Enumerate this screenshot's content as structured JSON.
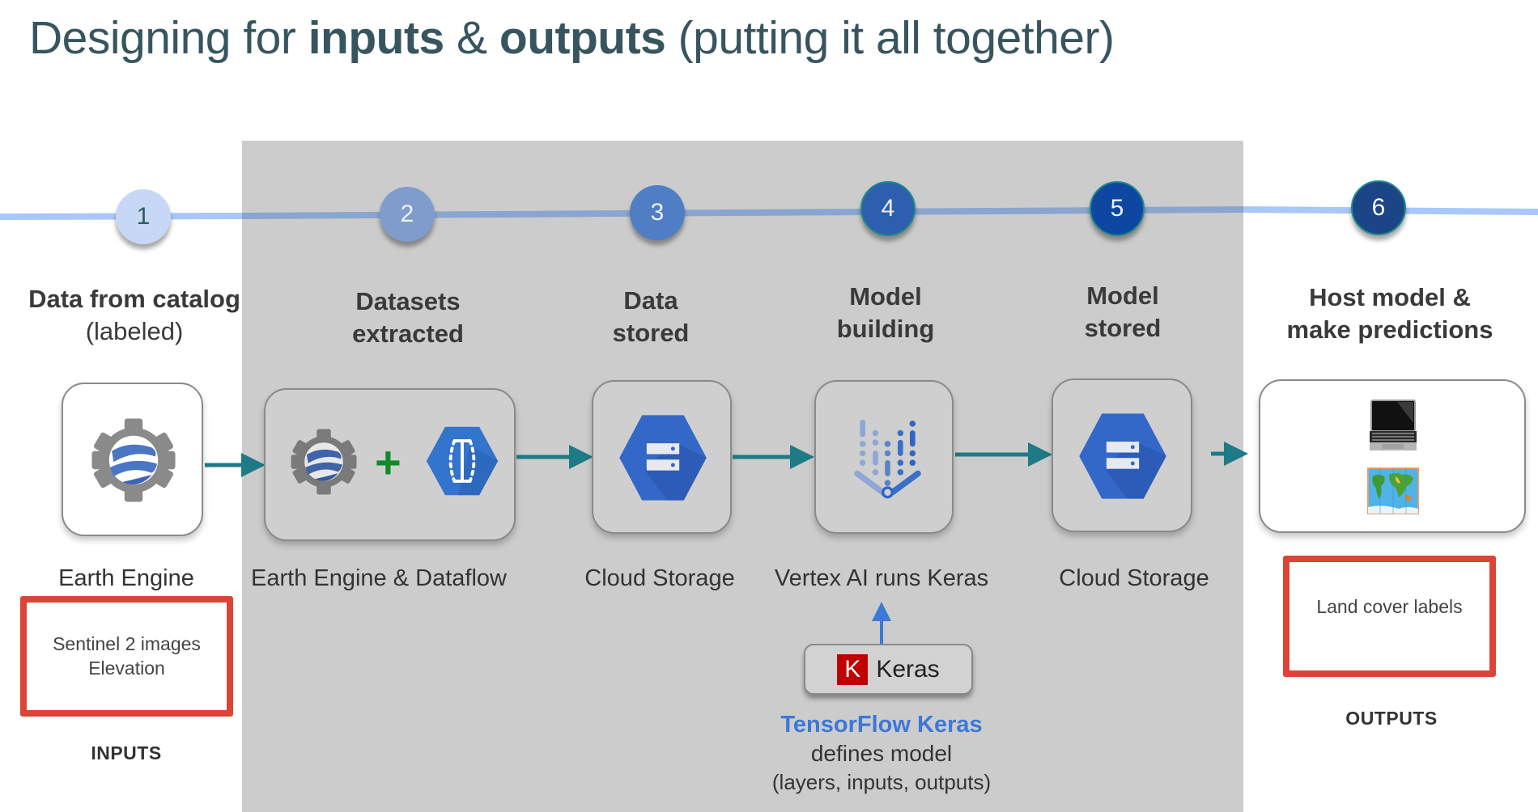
{
  "title": {
    "part1": "Designing for ",
    "bold1": "inputs",
    "part2": " & ",
    "bold2": "outputs",
    "part3": " (putting it all together)"
  },
  "colors": {
    "title": "#37555f",
    "panel": "#cccccc",
    "timeline_outside": "#a8c7fa",
    "timeline_inside": "#8aa5cf",
    "arrow": "#1f7a87",
    "red_box": "#db4437",
    "tf_blue": "#3c78d8",
    "keras_red": "#c00000"
  },
  "steps": [
    {
      "number": "1",
      "title": "Data from catalog",
      "subtitle": "(labeled)",
      "service": "Earth Engine",
      "fill": "#c6d8f5",
      "text_color": "#2f5b63"
    },
    {
      "number": "2",
      "title": "Datasets",
      "subtitle": "extracted",
      "service": "Earth Engine & Dataflow",
      "fill": "#7f9ccc",
      "text_color": "#eef2f8"
    },
    {
      "number": "3",
      "title": "Data",
      "subtitle": "stored",
      "service": "Cloud Storage",
      "fill": "#4f7ec4",
      "text_color": "#eef2f8"
    },
    {
      "number": "4",
      "title": "Model",
      "subtitle": "building",
      "service": "Vertex AI runs Keras",
      "fill": "#2e5fae",
      "text_color": "#eef2f8"
    },
    {
      "number": "5",
      "title": "Model",
      "subtitle": "stored",
      "service": "Cloud Storage",
      "fill": "#0d47a1",
      "text_color": "#eef2f8"
    },
    {
      "number": "6",
      "title": "Host model &",
      "subtitle": "make predictions",
      "service": "",
      "fill": "#1c4587",
      "text_color": "#ffffff"
    }
  ],
  "icons": {
    "earth_engine": "earth-engine-icon",
    "plus": "+",
    "dataflow": "dataflow-icon",
    "cloud_storage": "cloud-storage-icon",
    "vertex_ai": "vertex-ai-icon",
    "laptop": "laptop-icon",
    "world_map": "world-map-icon"
  },
  "inputs": {
    "lines": [
      "Sentinel 2 images",
      "Elevation"
    ],
    "label": "INPUTS"
  },
  "outputs": {
    "lines": [
      "Land cover labels"
    ],
    "label": "OUTPUTS"
  },
  "keras": {
    "logo_letter": "K",
    "label": "Keras",
    "note_title": "TensorFlow Keras",
    "note_line2": "defines model",
    "note_line3": "(layers, inputs, outputs)"
  }
}
